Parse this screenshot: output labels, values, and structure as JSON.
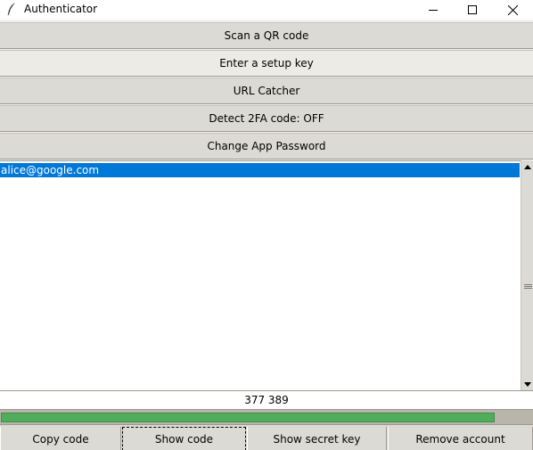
{
  "window": {
    "title": "Authenticator"
  },
  "actions": [
    {
      "label": "Scan a QR code"
    },
    {
      "label": "Enter a setup key"
    },
    {
      "label": "URL Catcher"
    },
    {
      "label": "Detect 2FA code: OFF"
    },
    {
      "label": "Change App Password"
    }
  ],
  "accounts": [
    "alice@google.com"
  ],
  "code": {
    "value": "377 389"
  },
  "timer": {
    "progress_percent": 93,
    "fill_color": "#4fad5b"
  },
  "bottom_buttons": {
    "copy": "Copy code",
    "show": "Show code",
    "secret": "Show secret key",
    "remove": "Remove account"
  },
  "colors": {
    "selection": "#0078d7",
    "button_face": "#dcdad5"
  }
}
